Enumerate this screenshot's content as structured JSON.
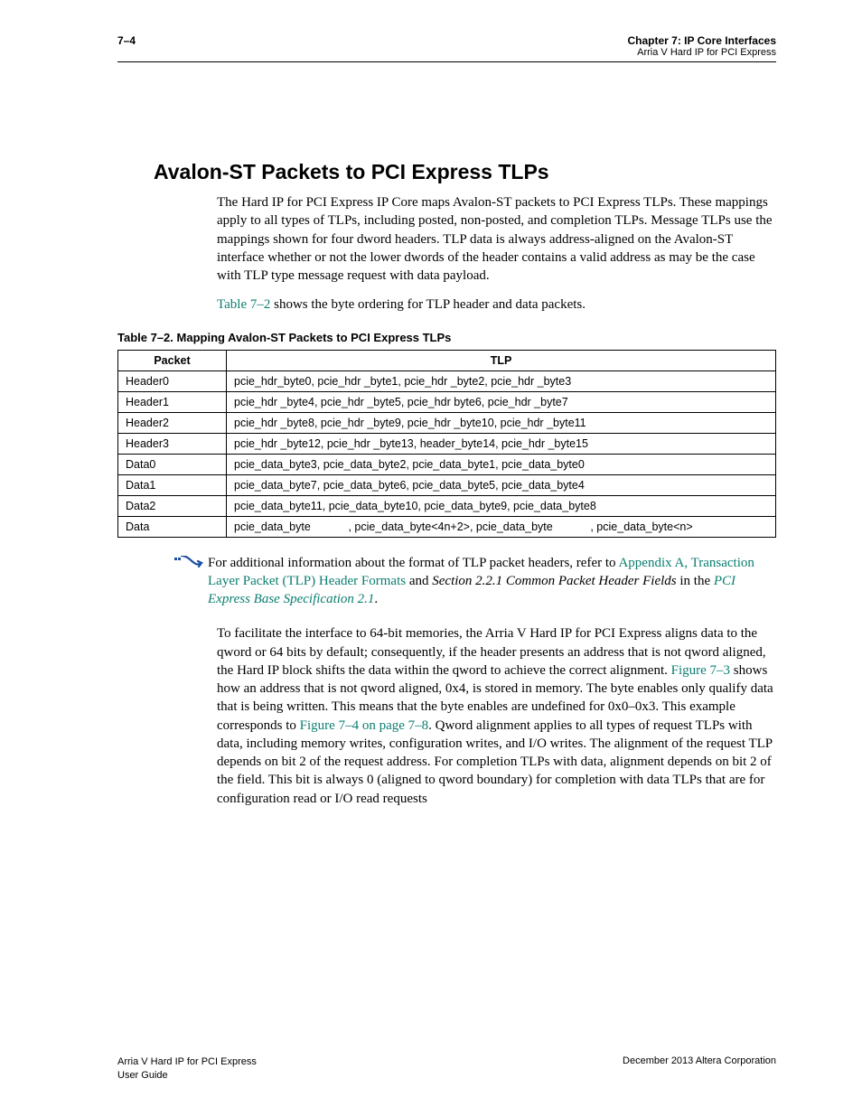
{
  "header": {
    "page_num": "7–4",
    "chapter": "Chapter 7: IP Core Interfaces",
    "sub": "Arria V Hard IP for PCI Express"
  },
  "section_title": "Avalon-ST Packets to PCI Express TLPs",
  "para1_a": "The Hard IP for PCI Express IP Core maps Avalon-ST packets to PCI Express TLPs. These mappings apply to all types of TLPs, including posted, non-posted, and completion TLPs. Message TLPs use the mappings shown for four dword headers. TLP data is always address-aligned on the Avalon-ST interface whether or not the lower dwords of the header contains a valid address as may be the case with TLP type message request with data payload.",
  "para2_link": "Table 7–2",
  "para2_rest": " shows the byte ordering for TLP header and data packets.",
  "table_caption": "Table 7–2. Mapping Avalon-ST Packets to PCI Express TLPs",
  "table": {
    "headers": [
      "Packet",
      "TLP"
    ],
    "rows": [
      [
        "Header0",
        "pcie_hdr_byte0, pcie_hdr _byte1, pcie_hdr _byte2, pcie_hdr _byte3"
      ],
      [
        "Header1",
        "pcie_hdr _byte4, pcie_hdr _byte5, pcie_hdr byte6, pcie_hdr _byte7"
      ],
      [
        "Header2",
        "pcie_hdr _byte8, pcie_hdr _byte9, pcie_hdr _byte10, pcie_hdr _byte11"
      ],
      [
        "Header3",
        "pcie_hdr _byte12, pcie_hdr _byte13, header_byte14, pcie_hdr _byte15"
      ],
      [
        "Data0",
        "pcie_data_byte3, pcie_data_byte2, pcie_data_byte1, pcie_data_byte0"
      ],
      [
        "Data1",
        "pcie_data_byte7, pcie_data_byte6, pcie_data_byte5, pcie_data_byte4"
      ],
      [
        "Data2",
        "pcie_data_byte11, pcie_data_byte10, pcie_data_byte9, pcie_data_byte8"
      ],
      [
        "Data",
        "pcie_data_byte            , pcie_data_byte<4n+2>, pcie_data_byte            , pcie_data_byte<n>"
      ]
    ]
  },
  "note": {
    "a": "For additional information about the format of TLP packet headers, refer to ",
    "link1": "Appendix A, Transaction Layer Packet (TLP) Header Formats",
    "b": " and ",
    "i1": "Section 2.2.1 Common Packet Header Fields",
    "c": " in the ",
    "link2": "PCI Express Base Specification 2.1",
    "d": "."
  },
  "para3": {
    "a": "To facilitate the interface to 64-bit memories, the Arria  V Hard IP for PCI Express aligns data to the qword or 64 bits by default; consequently, if the header presents an address that is not qword aligned, the Hard IP block shifts the data within the qword to achieve the correct alignment. ",
    "link1": "Figure 7–3",
    "b": " shows how an address that is not qword aligned, 0x4, is stored in memory. The byte enables only qualify data that is being written. This means that the byte enables are undefined for 0x0–0x3. This example corresponds to ",
    "link2": "Figure 7–4 on page 7–8",
    "c": ". Qword alignment applies to all types of request TLPs with data, including memory writes, configuration writes, and I/O writes. The alignment of the request TLP depends on bit 2 of the request address. For completion TLPs with data, alignment depends on bit 2 of the                       field. This bit is always 0 (aligned to qword boundary) for completion with data TLPs that are for configuration read or I/O read requests"
  },
  "footer": {
    "left1": "Arria V Hard IP for PCI Express",
    "left2": "User Guide",
    "right": "December 2013   Altera Corporation"
  }
}
